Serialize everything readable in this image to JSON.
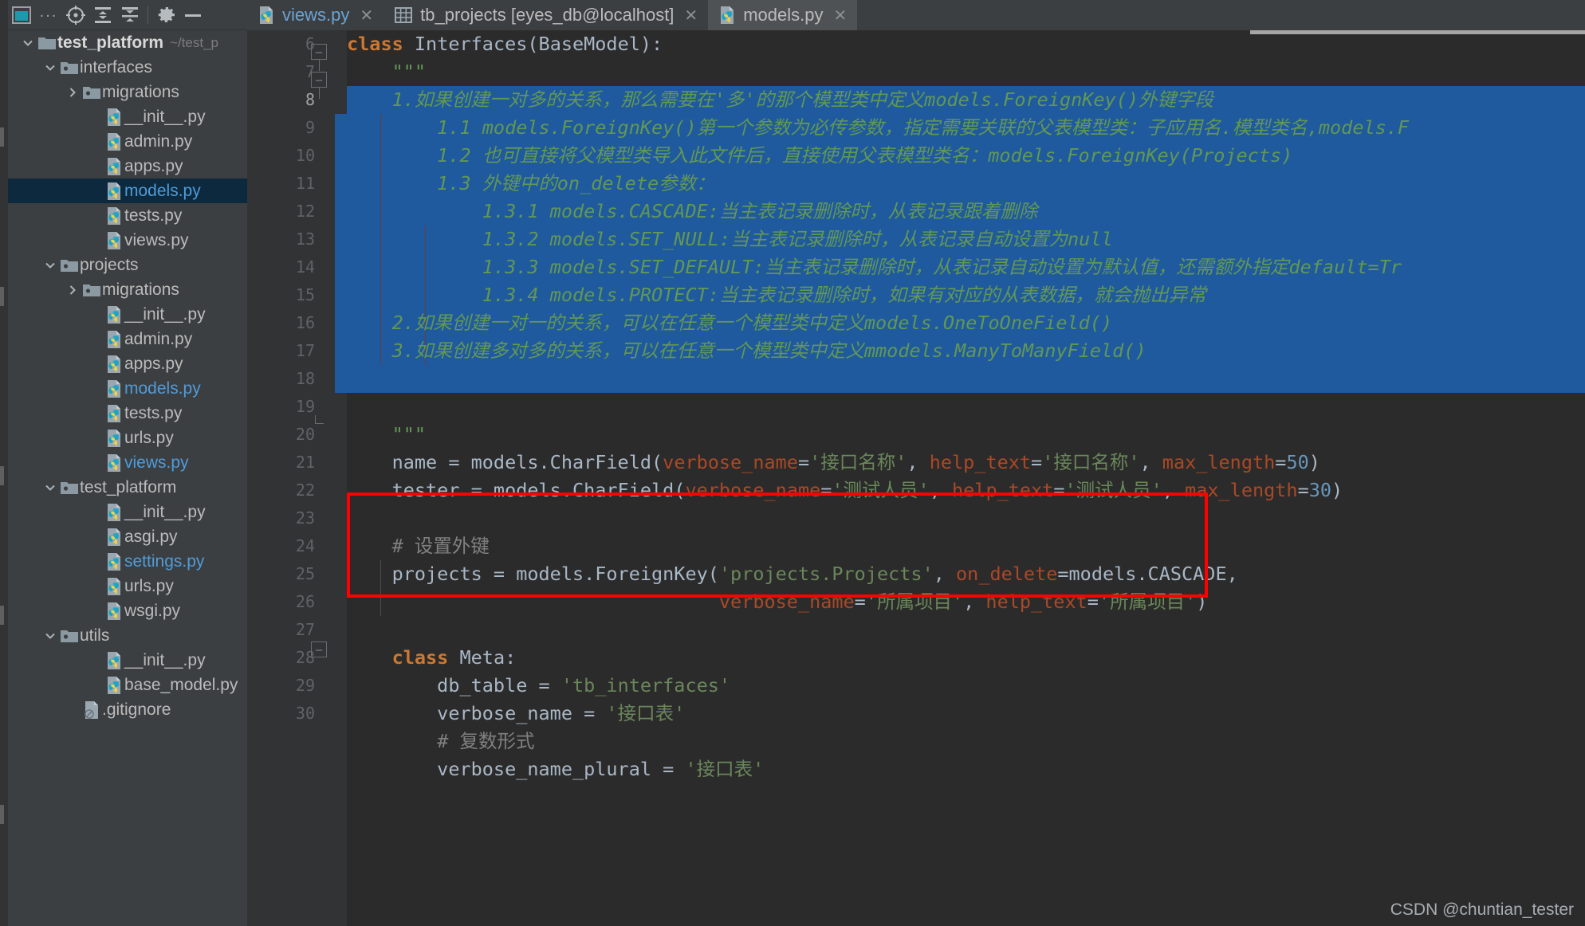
{
  "toolbar": {
    "project_icon": "project-window-icon",
    "more_label": "...",
    "locate_icon": "locate-target-icon",
    "expand_all_icon": "expand-all-icon",
    "collapse_all_icon": "collapse-all-icon",
    "settings_icon": "gear-icon",
    "hide_icon": "minimize-icon"
  },
  "tabs": [
    {
      "label": "views.py",
      "icon": "python-file-icon",
      "active": false,
      "accent": "#6aa3d5",
      "close": "✕"
    },
    {
      "label": "tb_projects [eyes_db@localhost]",
      "icon": "database-table-icon",
      "active": false,
      "accent": "#bbbbbb",
      "close": "✕"
    },
    {
      "label": "models.py",
      "icon": "python-file-icon",
      "active": true,
      "accent": "#bbbbbb",
      "close": "✕"
    }
  ],
  "tree": [
    {
      "depth": 0,
      "chev": "v",
      "icon": "folder",
      "label": "test_platform",
      "bold": true,
      "blue": false,
      "sub": "~/test_p",
      "selected": false
    },
    {
      "depth": 1,
      "chev": "v",
      "icon": "module-folder",
      "label": "interfaces",
      "bold": false,
      "blue": false,
      "sub": "",
      "selected": false
    },
    {
      "depth": 2,
      "chev": ">",
      "icon": "module-folder",
      "label": "migrations",
      "bold": false,
      "blue": false,
      "sub": "",
      "selected": false
    },
    {
      "depth": 3,
      "chev": "",
      "icon": "python",
      "label": "__init__.py",
      "bold": false,
      "blue": false,
      "sub": "",
      "selected": false
    },
    {
      "depth": 3,
      "chev": "",
      "icon": "python",
      "label": "admin.py",
      "bold": false,
      "blue": false,
      "sub": "",
      "selected": false
    },
    {
      "depth": 3,
      "chev": "",
      "icon": "python",
      "label": "apps.py",
      "bold": false,
      "blue": false,
      "sub": "",
      "selected": false
    },
    {
      "depth": 3,
      "chev": "",
      "icon": "python",
      "label": "models.py",
      "bold": false,
      "blue": true,
      "sub": "",
      "selected": true
    },
    {
      "depth": 3,
      "chev": "",
      "icon": "python",
      "label": "tests.py",
      "bold": false,
      "blue": false,
      "sub": "",
      "selected": false
    },
    {
      "depth": 3,
      "chev": "",
      "icon": "python",
      "label": "views.py",
      "bold": false,
      "blue": false,
      "sub": "",
      "selected": false
    },
    {
      "depth": 1,
      "chev": "v",
      "icon": "module-folder",
      "label": "projects",
      "bold": false,
      "blue": false,
      "sub": "",
      "selected": false
    },
    {
      "depth": 2,
      "chev": ">",
      "icon": "module-folder",
      "label": "migrations",
      "bold": false,
      "blue": false,
      "sub": "",
      "selected": false
    },
    {
      "depth": 3,
      "chev": "",
      "icon": "python",
      "label": "__init__.py",
      "bold": false,
      "blue": false,
      "sub": "",
      "selected": false
    },
    {
      "depth": 3,
      "chev": "",
      "icon": "python",
      "label": "admin.py",
      "bold": false,
      "blue": false,
      "sub": "",
      "selected": false
    },
    {
      "depth": 3,
      "chev": "",
      "icon": "python",
      "label": "apps.py",
      "bold": false,
      "blue": false,
      "sub": "",
      "selected": false
    },
    {
      "depth": 3,
      "chev": "",
      "icon": "python",
      "label": "models.py",
      "bold": false,
      "blue": true,
      "sub": "",
      "selected": false
    },
    {
      "depth": 3,
      "chev": "",
      "icon": "python",
      "label": "tests.py",
      "bold": false,
      "blue": false,
      "sub": "",
      "selected": false
    },
    {
      "depth": 3,
      "chev": "",
      "icon": "python",
      "label": "urls.py",
      "bold": false,
      "blue": false,
      "sub": "",
      "selected": false
    },
    {
      "depth": 3,
      "chev": "",
      "icon": "python",
      "label": "views.py",
      "bold": false,
      "blue": true,
      "sub": "",
      "selected": false
    },
    {
      "depth": 1,
      "chev": "v",
      "icon": "module-folder",
      "label": "test_platform",
      "bold": false,
      "blue": false,
      "sub": "",
      "selected": false
    },
    {
      "depth": 3,
      "chev": "",
      "icon": "python",
      "label": "__init__.py",
      "bold": false,
      "blue": false,
      "sub": "",
      "selected": false
    },
    {
      "depth": 3,
      "chev": "",
      "icon": "python",
      "label": "asgi.py",
      "bold": false,
      "blue": false,
      "sub": "",
      "selected": false
    },
    {
      "depth": 3,
      "chev": "",
      "icon": "python",
      "label": "settings.py",
      "bold": false,
      "blue": true,
      "sub": "",
      "selected": false
    },
    {
      "depth": 3,
      "chev": "",
      "icon": "python",
      "label": "urls.py",
      "bold": false,
      "blue": false,
      "sub": "",
      "selected": false
    },
    {
      "depth": 3,
      "chev": "",
      "icon": "python",
      "label": "wsgi.py",
      "bold": false,
      "blue": false,
      "sub": "",
      "selected": false
    },
    {
      "depth": 1,
      "chev": "v",
      "icon": "module-folder",
      "label": "utils",
      "bold": false,
      "blue": false,
      "sub": "",
      "selected": false
    },
    {
      "depth": 3,
      "chev": "",
      "icon": "python",
      "label": "__init__.py",
      "bold": false,
      "blue": false,
      "sub": "",
      "selected": false
    },
    {
      "depth": 3,
      "chev": "",
      "icon": "python",
      "label": "base_model.py",
      "bold": false,
      "blue": false,
      "sub": "",
      "selected": false
    },
    {
      "depth": 2,
      "chev": "",
      "icon": "ignored-file",
      "label": ".gitignore",
      "bold": false,
      "blue": false,
      "sub": "",
      "selected": false
    }
  ],
  "editor": {
    "file": "models.py",
    "first_line": 6,
    "last_line": 30,
    "line_numbers": [
      6,
      7,
      8,
      9,
      10,
      11,
      12,
      13,
      14,
      15,
      16,
      17,
      18,
      19,
      20,
      21,
      22,
      23,
      24,
      25,
      26,
      27,
      28,
      29,
      30
    ],
    "current_line": 8,
    "selection_color": "#1f5a9e",
    "annotation_box_color": "#ff0000",
    "lines": {
      "6": "class Interfaces(BaseModel):",
      "7": "    \"\"\"",
      "8": "    1.如果创建一对多的关系，那么需要在'多'的那个模型类中定义models.ForeignKey()外键字段",
      "9": "        1.1 models.ForeignKey()第一个参数为必传参数，指定需要关联的父表模型类：子应用名.模型类名,models.F",
      "10": "        1.2 也可直接将父模型类导入此文件后，直接使用父表模型类名：models.ForeignKey(Projects)",
      "11": "        1.3 外键中的on_delete参数：",
      "12": "            1.3.1 models.CASCADE:当主表记录删除时，从表记录跟着删除",
      "13": "            1.3.2 models.SET_NULL:当主表记录删除时，从表记录自动设置为null",
      "14": "            1.3.3 models.SET_DEFAULT:当主表记录删除时，从表记录自动设置为默认值，还需额外指定default=Tr",
      "15": "            1.3.4 models.PROTECT:当主表记录删除时，如果有对应的从表数据，就会抛出异常",
      "16": "    2.如果创建一对一的关系，可以在任意一个模型类中定义models.OneToOneField()",
      "17": "    3.如果创建多对多的关系，可以在任意一个模型类中定义mmodels.ManyToManyField()",
      "18": "",
      "19": "    \"\"\"",
      "20": "    name = models.CharField(verbose_name='接口名称', help_text='接口名称', max_length=50)",
      "21": "    tester = models.CharField(verbose_name='测试人员', help_text='测试人员', max_length=30)",
      "22": "",
      "23": "    # 设置外键",
      "24": "    projects = models.ForeignKey('projects.Projects', on_delete=models.CASCADE,",
      "25": "                                 verbose_name='所属项目', help_text='所属项目')",
      "26": "",
      "27": "    class Meta:",
      "28": "        db_table = 'tb_interfaces'",
      "29": "        verbose_name = '接口表'",
      "30": "        # 复数形式"
    }
  },
  "watermark": "CSDN @chuntian_tester"
}
